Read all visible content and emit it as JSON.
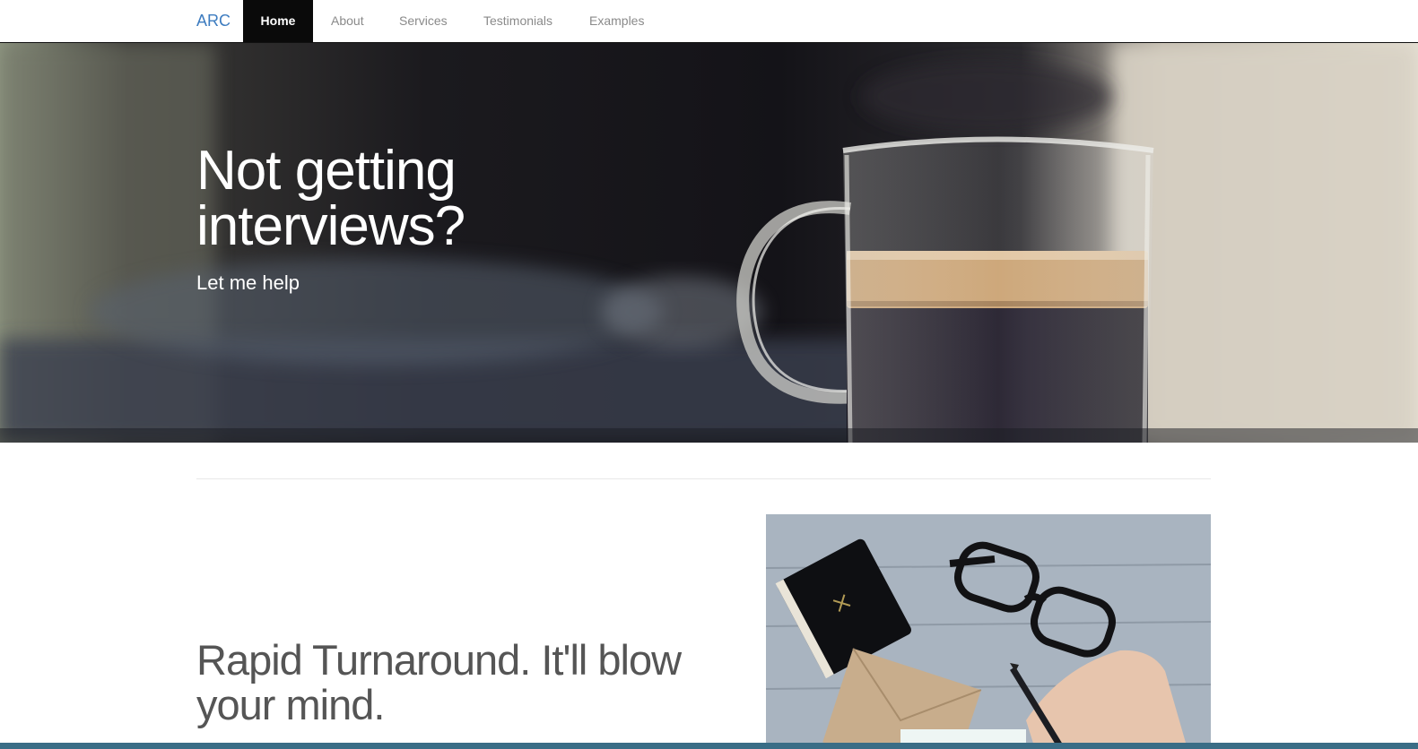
{
  "navbar": {
    "brand": "ARC",
    "items": [
      {
        "label": "Home",
        "active": true
      },
      {
        "label": "About",
        "active": false
      },
      {
        "label": "Services",
        "active": false
      },
      {
        "label": "Testimonials",
        "active": false
      },
      {
        "label": "Examples",
        "active": false
      }
    ]
  },
  "hero": {
    "title": "Not getting interviews?",
    "subtitle": "Let me help"
  },
  "feature": {
    "heading": "Rapid Turnaround. It'll blow your mind."
  },
  "colors": {
    "brand": "#3d7cc0",
    "nav_active_bg": "#0a0a0a",
    "nav_text": "#8a8a8a",
    "heading_text": "#555555"
  }
}
